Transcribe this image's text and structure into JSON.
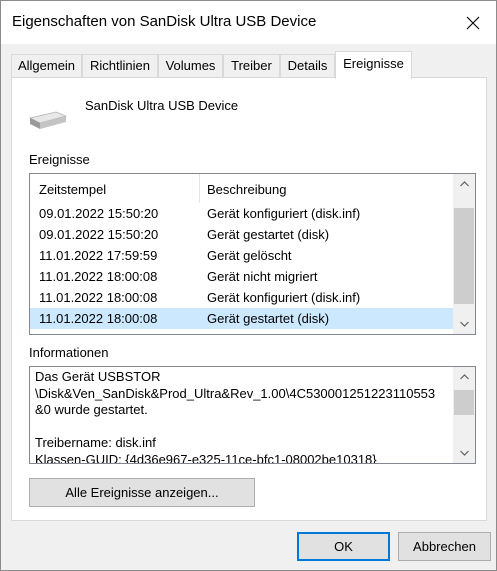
{
  "window": {
    "title": "Eigenschaften von SanDisk Ultra USB Device"
  },
  "tabs": [
    {
      "label": "Allgemein"
    },
    {
      "label": "Richtlinien"
    },
    {
      "label": "Volumes"
    },
    {
      "label": "Treiber"
    },
    {
      "label": "Details"
    },
    {
      "label": "Ereignisse"
    }
  ],
  "active_tab": "Ereignisse",
  "device": {
    "name": "SanDisk Ultra USB Device",
    "icon": "usb-drive-icon"
  },
  "events": {
    "label": "Ereignisse",
    "columns": {
      "timestamp": "Zeitstempel",
      "description": "Beschreibung"
    },
    "rows": [
      {
        "timestamp": "09.01.2022 15:50:20",
        "description": "Gerät konfiguriert (disk.inf)"
      },
      {
        "timestamp": "09.01.2022 15:50:20",
        "description": "Gerät gestartet (disk)"
      },
      {
        "timestamp": "11.01.2022 17:59:59",
        "description": "Gerät gelöscht"
      },
      {
        "timestamp": "11.01.2022 18:00:08",
        "description": "Gerät nicht migriert"
      },
      {
        "timestamp": "11.01.2022 18:00:08",
        "description": "Gerät konfiguriert (disk.inf)"
      },
      {
        "timestamp": "11.01.2022 18:00:08",
        "description": "Gerät gestartet (disk)"
      }
    ],
    "selected_index": 5
  },
  "info": {
    "label": "Informationen",
    "lines": [
      "Das Gerät USBSTOR",
      "\\Disk&Ven_SanDisk&Prod_Ultra&Rev_1.00\\4C530001251223110553",
      "&0 wurde gestartet.",
      "",
      "Treibername: disk.inf",
      "Klassen-GUID: {4d36e967-e325-11ce-bfc1-08002be10318}"
    ]
  },
  "buttons": {
    "show_all": "Alle Ereignisse anzeigen...",
    "ok": "OK",
    "cancel": "Abbrechen"
  },
  "colors": {
    "selection": "#cce8ff",
    "accent": "#0078d7",
    "dialog_bg": "#f0f0f0"
  }
}
